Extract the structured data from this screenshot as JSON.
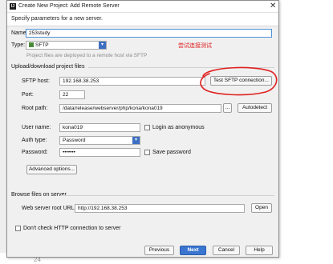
{
  "window": {
    "title": "Create New Project: Add Remote Server",
    "icon_name": "intellij-app-icon",
    "close_symbol": "✕"
  },
  "header": {
    "text": "Specify parameters for a new server."
  },
  "server": {
    "name_label": "Name:",
    "name_value": "253study",
    "type_label": "Type:",
    "type_value": "SFTP",
    "type_hint": "Project files are deployed to a remote host via SFTP",
    "annotation": "尝试连接测试"
  },
  "upload": {
    "section_title": "Upload/download project files",
    "host_label": "SFTP host:",
    "host_value": "192.168.38.253",
    "test_button": "Test SFTP connection...",
    "port_label": "Port:",
    "port_value": "22",
    "root_label": "Root path:",
    "root_value": "/data/release/webserver/php/kona/kona019",
    "browse_button": "...",
    "autodetect_button": "Autodetect",
    "user_label": "User name:",
    "user_value": "kona019",
    "anonymous_label": "Login as anonymous",
    "auth_label": "Auth type:",
    "auth_value": "Password",
    "password_label": "Password:",
    "password_value": "•••••••",
    "save_password_label": "Save password",
    "advanced_button": "Advanced options..."
  },
  "browse": {
    "section_title": "Browse files on server",
    "url_label": "Web server root URL:",
    "url_value": "http://192.168.38.253",
    "open_button": "Open"
  },
  "footer": {
    "dont_check_label": "Don't check HTTP connection to server",
    "previous_button": "Previous",
    "next_button": "Next",
    "cancel_button": "Cancel",
    "help_button": "Help"
  },
  "background": {
    "line_number": "24"
  },
  "colors": {
    "primary_button": "#3a75d0",
    "annotation_red": "#e02020",
    "focus_border": "#4d90d8",
    "dialog_bg": "#f0f0f0"
  }
}
